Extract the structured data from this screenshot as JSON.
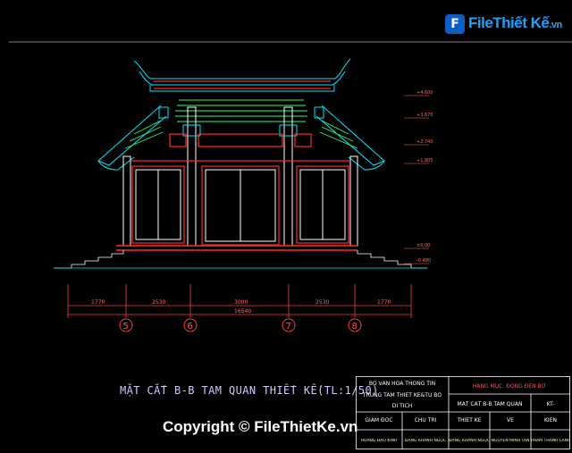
{
  "watermark_logo": {
    "mark": "F",
    "text": "FileThiết Kế",
    "suffix": ".vn"
  },
  "drawing_title": "MẶT CẮT B-B TAM QUAN THIẾT KẾ(TL:1/50)",
  "copyright": "Copyright © FileThietKe.vn",
  "dimensions": {
    "segments": [
      "1770",
      "2530",
      "3000",
      "2530",
      "1770"
    ],
    "total": "16540"
  },
  "axes": [
    "5",
    "6",
    "7",
    "8"
  ],
  "levels": [
    "+4.600",
    "+3.670",
    "+2.740",
    "+1.905",
    "±0.00",
    "-0.480"
  ],
  "title_block": {
    "org_line1": "BỘ VĂN HÓA THÔNG TIN",
    "org_line2": "TRUNG TÂM THIẾT KẾ&TU BỔ",
    "org_line3": "DI TÍCH",
    "project": "HẠNG MỤC: ĐỘNG ĐÈN BỜ",
    "sheet_name": "MẶT CẮT B-B TAM QUAN",
    "sheet_code": "KT-",
    "role_director": "GIÁM ĐỐC",
    "role_lead": "CHỦ TRÌ",
    "role_design": "THIẾT KẾ",
    "role_draw": "VẼ",
    "role_check": "KIỂN",
    "name_1": "HOÀNG ĐẠO KÍNH",
    "name_2": "ĐẶNG KHÁNH NGỌC",
    "name_3": "ĐẶNG KHÁNH NGỌC",
    "name_4": "NGUYỄN MINH TÂN",
    "name_5": "PHẠM THANH LÀNG"
  },
  "colors": {
    "background": "#000000",
    "cyan": "#00e5ff",
    "red": "#ff2a2a",
    "green": "#2aff6a",
    "white": "#ffffff",
    "magenta": "#ff40ff",
    "yellow": "#ffff33"
  }
}
